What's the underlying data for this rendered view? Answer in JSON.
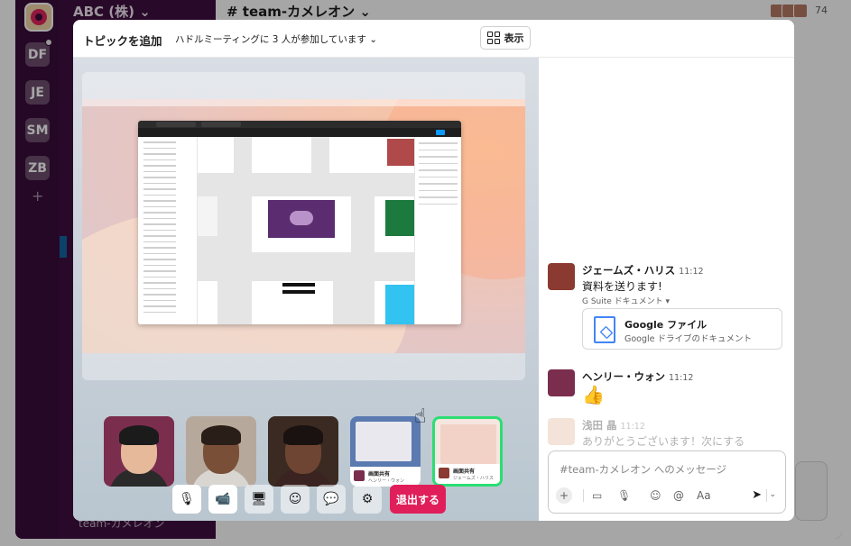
{
  "workspace": {
    "name": "ABC (株) ⌄",
    "switcher": [
      "DF",
      "JE",
      "SM",
      "ZB"
    ],
    "add": "+"
  },
  "channel": {
    "title": "# team-カメレオン ⌄",
    "member_count": "74",
    "bg_sidebar_text": "team-カメレオン"
  },
  "huddle": {
    "topic_button": "トピックを追加",
    "participants_info": "ハドルミーティングに 3 人が参加しています ⌄",
    "view_button": "表示",
    "leave_button": "退出する",
    "share_tiles": [
      {
        "name": "画面共有",
        "sub": "ヘンリー・ウォン"
      },
      {
        "name": "画面共有",
        "sub": "ジェームズ・ハリス"
      }
    ],
    "controls": [
      {
        "name": "microphone-icon",
        "glyph": "🎙"
      },
      {
        "name": "video-icon",
        "glyph": "📹"
      },
      {
        "name": "screen-share-icon",
        "glyph": "🖥"
      },
      {
        "name": "emoji-icon",
        "glyph": "☺"
      },
      {
        "name": "chat-icon",
        "glyph": "💬"
      },
      {
        "name": "settings-icon",
        "glyph": "⚙"
      }
    ]
  },
  "messages": [
    {
      "author": "ジェームズ・ハリス",
      "time": "11:12",
      "text": "資料を送ります!",
      "attachment_header": "G Suite ドキュメント ▾",
      "file": {
        "name": "Google ファイル",
        "sub": "Google ドライブのドキュメント"
      }
    },
    {
      "author": "ヘンリー・ウォン",
      "time": "11:12",
      "text": "👍"
    },
    {
      "author": "浅田 晶",
      "time": "11:12",
      "text": "ありがとうございます！次にする"
    }
  ],
  "composer": {
    "placeholder": "#team-カメレオン へのメッセージ",
    "format_label": "Aa"
  },
  "colors": {
    "aubergine": "#3f0e40",
    "leave_red": "#e01e5a",
    "active_speaker": "#2bde73"
  }
}
